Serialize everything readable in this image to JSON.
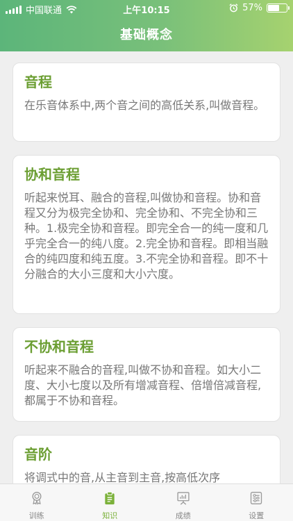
{
  "status_bar": {
    "carrier": "中国联通",
    "time": "上午10:15",
    "battery_percent": "57%",
    "battery_level": 0.57
  },
  "header": {
    "title": "基础概念"
  },
  "cards": [
    {
      "title": "音程",
      "body": "在乐音体系中,两个音之间的高低关系,叫做音程。"
    },
    {
      "title": "协和音程",
      "body": "听起来悦耳、融合的音程,叫做协和音程。协和音程又分为极完全协和、完全协和、不完全协和三种。1.极完全协和音程。即完全合一的纯一度和几乎完全合一的纯八度。2.完全协和音程。即相当融合的纯四度和纯五度。3.不完全协和音程。即不十分融合的大小三度和大小六度。"
    },
    {
      "title": "不协和音程",
      "body": "听起来不融合的音程,叫做不协和音程。如大小二度、大小七度以及所有增减音程、倍增倍减音程,都属于不协和音程。"
    },
    {
      "title": "音阶",
      "body": "将调式中的音,从主音到主音,按高低次序"
    }
  ],
  "tabs": [
    {
      "label": "训练",
      "icon": "medal-icon",
      "active": false
    },
    {
      "label": "知识",
      "icon": "clipboard-icon",
      "active": true
    },
    {
      "label": "成绩",
      "icon": "chart-board-icon",
      "active": false
    },
    {
      "label": "设置",
      "icon": "sliders-icon",
      "active": false
    }
  ],
  "colors": {
    "accent": "#7bb13a",
    "title_green": "#6b9e32",
    "header_start": "#5cb57a",
    "header_end": "#a6d26f"
  }
}
